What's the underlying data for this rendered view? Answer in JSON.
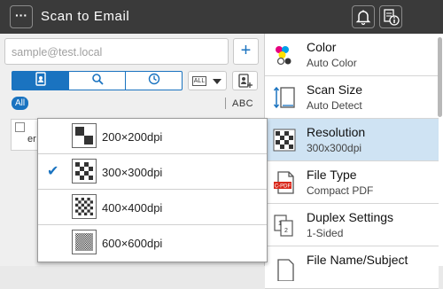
{
  "header": {
    "menu_label": "···",
    "title": "Scan to Email"
  },
  "address": {
    "placeholder": "sample@test.local",
    "add_label": "+"
  },
  "filter": {
    "all_box": "ALL",
    "all_chip": "All",
    "abc_label": "ABC"
  },
  "entry": {
    "text": "er"
  },
  "resolution_popup": {
    "selected": "300×300dpi",
    "options": [
      {
        "label": "200×200dpi"
      },
      {
        "label": "300×300dpi"
      },
      {
        "label": "400×400dpi"
      },
      {
        "label": "600×600dpi"
      }
    ]
  },
  "settings": [
    {
      "name": "Color",
      "value": "Auto Color",
      "icon": "color-icon"
    },
    {
      "name": "Scan Size",
      "value": "Auto Detect",
      "icon": "scan-size-icon"
    },
    {
      "name": "Resolution",
      "value": "300x300dpi",
      "icon": "resolution-icon"
    },
    {
      "name": "File Type",
      "value": "Compact PDF",
      "icon": "file-type-icon",
      "badge": "C-PDF"
    },
    {
      "name": "Duplex Settings",
      "value": "1-Sided",
      "icon": "duplex-icon"
    },
    {
      "name": "File Name/Subject",
      "value": "",
      "icon": "file-name-icon"
    }
  ],
  "colors": {
    "accent": "#1a73c0",
    "topbar": "#3a3a3a",
    "selected_row": "#cfe3f3"
  }
}
